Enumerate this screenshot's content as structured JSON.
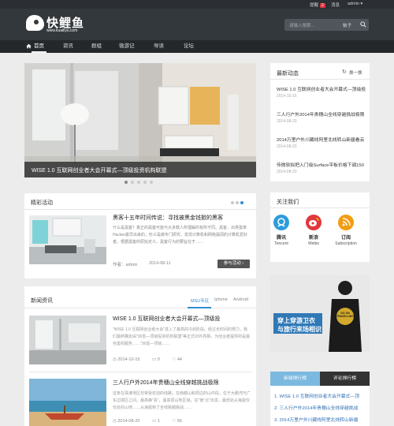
{
  "topbar": {
    "notify_label": "提醒",
    "notify_count": "2",
    "link": "消息",
    "user": "admin"
  },
  "header": {
    "brand": "快鲤鱼",
    "url": "www.kuailiyu.com",
    "search_placeholder": "请输入搜索...",
    "search_button": "帖子"
  },
  "nav": {
    "items": [
      {
        "label": "首页"
      },
      {
        "label": "资讯"
      },
      {
        "label": "群组"
      },
      {
        "label": "微游记"
      },
      {
        "label": "导读"
      },
      {
        "label": "论坛"
      }
    ]
  },
  "slider": {
    "caption": "WISE 1.0 互联网创业者大会开幕式—顶级投资机构联盟"
  },
  "featured": {
    "title": "精彩活动",
    "item_title": "黑客十五年时间传说：寻找被黑金钱掀的黑客",
    "item_desc": "什么是黑客？真正的黑客可能与大多数人所理解的有所不同。黑客，出类拔萃 Hacker最早出来的，形义是做专门研究、发现计算机和网络漏洞的计算机爱好者。根据黑客的原始定义，黑客行为的要旨在于……",
    "author": "作者：admin",
    "date": "2014-08-11",
    "button": "参与活动"
  },
  "news": {
    "title": "新闻资讯",
    "tabs": [
      {
        "label": "MSU专区"
      },
      {
        "label": "Iphone"
      },
      {
        "label": "Android"
      }
    ],
    "items": [
      {
        "title": "WISE 1.0 互联网创业者大会开幕式—顶级投",
        "desc": "\"WISE 1.0 互联网创业者大会\"进入了最高的冷启阶段。经过长时间的努力，我们最终确定由\"36氪—顶级投资机构联盟\"等正式对外亮相，为创业者提供的是最完善的服务……\"36氪—顶级……",
        "date": "2014-10-15",
        "views": "0",
        "likes": "44"
      },
      {
        "title": "三人行户外2014年贵穗山全线穿越挑战极限",
        "desc": "这条在珠港地区非常受欢迎的线路，在南都山和周边的山中段，位于大鹏湾与广东边境区之间。最高峰\"贵\"，属高原山地区域，在\"南\"北\"出发，最低处从海拔仅仅处的山地……从海拔到了全线跨越挑战……",
        "date": "2014-08-20",
        "views": "1",
        "likes": "56"
      }
    ]
  },
  "right": {
    "dynamic": {
      "title": "最新动态",
      "refresh": "换一换",
      "items": [
        {
          "text": "WISE 1.0 互联网创业者大会开幕式—顶级投",
          "date": "2014-10-15"
        },
        {
          "text": "三人行户外2014年贵穗山全线穿越挑战极限",
          "date": "2014-08-20"
        },
        {
          "text": "2014万里户外川藏线阿里北线转山新疆看云",
          "date": "2014-08-20"
        },
        {
          "text": "传微软拟把入门级Surface平板价格下调150",
          "date": "2014-08-20"
        }
      ]
    },
    "follow": {
      "title": "关注我们",
      "items": [
        {
          "name": "腾讯",
          "sub": "Tencent",
          "icon": "tencent-icon",
          "color": "#2d9cdb"
        },
        {
          "name": "新浪",
          "sub": "Weibo",
          "icon": "weibo-icon",
          "color": "#e0383d"
        },
        {
          "name": "订阅",
          "sub": "Subscription",
          "icon": "rss-icon",
          "color": "#f39c12"
        }
      ]
    },
    "ad": {
      "line1": "穿上穿游卫衣",
      "line2": "与旅行来场相识",
      "logo": "GO ON TRAVELLING"
    },
    "rank": {
      "tabs": [
        {
          "label": "新闻排行榜"
        },
        {
          "label": "评论排行榜"
        }
      ],
      "items": [
        {
          "no": "1.",
          "text": "WISE 1.0 互联网创业者大会开幕式—顶"
        },
        {
          "no": "2.",
          "text": "三人行户外2014年贵穗山全线穿越挑战"
        },
        {
          "no": "3.",
          "text": "2014万里户外川藏线阿里北线转山新疆"
        }
      ]
    }
  },
  "colors": {
    "header": "#33383c",
    "nav": "#24282b",
    "accent": "#2f8ed4",
    "button": "#555555"
  }
}
